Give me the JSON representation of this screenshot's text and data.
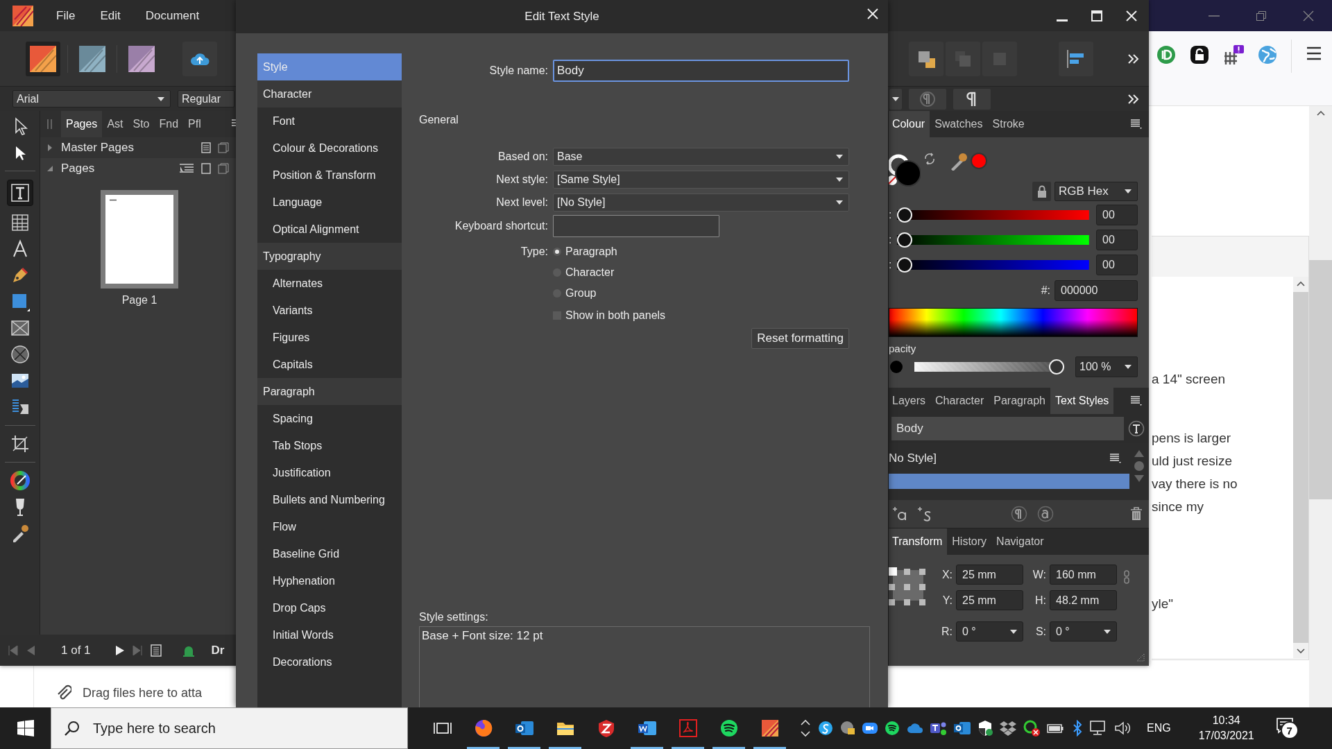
{
  "browser": {
    "text_lines": [
      [
        "a 14\" screen"
      ],
      [
        "pens is larger",
        "uld just resize",
        "vay there is no",
        "since my"
      ],
      [
        "yle\""
      ]
    ],
    "drop_hint": "Drag files here to atta"
  },
  "affinity": {
    "menu": [
      "File",
      "Edit",
      "Document"
    ],
    "font_family": "Arial",
    "font_style": "Regular",
    "pages_panel": {
      "tabs": [
        {
          "label": "Pages",
          "selected": true
        },
        {
          "label": "Ast",
          "selected": false
        },
        {
          "label": "Sto",
          "selected": false
        },
        {
          "label": "Fnd",
          "selected": false
        },
        {
          "label": "Pfl",
          "selected": false
        }
      ],
      "sections": [
        {
          "label": "Master Pages",
          "expanded": false
        },
        {
          "label": "Pages",
          "expanded": true
        }
      ],
      "page_label": "Page 1"
    },
    "status_bar": {
      "page_count": "1 of 1",
      "label": "Dr"
    },
    "colour_panel": {
      "tabs": [
        {
          "label": "Colour",
          "selected": true
        },
        {
          "label": "Swatches",
          "selected": false
        },
        {
          "label": "Stroke",
          "selected": false
        }
      ],
      "model": "RGB Hex",
      "channels": [
        {
          "label": ":",
          "level": 0,
          "value": "00"
        },
        {
          "label": ":",
          "level": 0,
          "value": "00"
        },
        {
          "label": ":",
          "level": 0,
          "value": "00"
        }
      ],
      "hex_label": "#:",
      "hex": "000000",
      "opacity_label": "pacity",
      "opacity": {
        "level": 1,
        "value": "100 %"
      }
    },
    "styles_panel": {
      "tabs": [
        {
          "label": "Layers",
          "selected": false
        },
        {
          "label": "Character",
          "selected": false
        },
        {
          "label": "Paragraph",
          "selected": false
        },
        {
          "label": "Text Styles",
          "selected": true
        }
      ],
      "current": "Body",
      "styles": [
        {
          "label": "No Style]",
          "selected": false
        },
        {
          "selected": true
        }
      ]
    },
    "transform_panel": {
      "tabs": [
        {
          "label": "Transform",
          "selected": true
        },
        {
          "label": "History",
          "selected": false
        },
        {
          "label": "Navigator",
          "selected": false
        }
      ],
      "fields": [
        {
          "label": "X:",
          "value": "25 mm",
          "kind": "field"
        },
        {
          "label": "W:",
          "value": "160 mm",
          "kind": "field"
        },
        {
          "label": "Y:",
          "value": "25 mm",
          "kind": "field"
        },
        {
          "label": "H:",
          "value": "48.2 mm",
          "kind": "field"
        },
        {
          "label": "R:",
          "value": "0 °",
          "kind": "dropdown"
        },
        {
          "label": "S:",
          "value": "0 °",
          "kind": "dropdown"
        }
      ]
    }
  },
  "dialog": {
    "title": "Edit Text Style",
    "nav": [
      {
        "label": "Style",
        "kind": "group",
        "selected": true
      },
      {
        "label": "Character",
        "kind": "group",
        "selected": false
      },
      {
        "label": "Font",
        "kind": "item",
        "selected": false
      },
      {
        "label": "Colour & Decorations",
        "kind": "item",
        "selected": false
      },
      {
        "label": "Position & Transform",
        "kind": "item",
        "selected": false
      },
      {
        "label": "Language",
        "kind": "item",
        "selected": false
      },
      {
        "label": "Optical Alignment",
        "kind": "item",
        "selected": false
      },
      {
        "label": "Typography",
        "kind": "group",
        "selected": false
      },
      {
        "label": "Alternates",
        "kind": "item",
        "selected": false
      },
      {
        "label": "Variants",
        "kind": "item",
        "selected": false
      },
      {
        "label": "Figures",
        "kind": "item",
        "selected": false
      },
      {
        "label": "Capitals",
        "kind": "item",
        "selected": false
      },
      {
        "label": "Paragraph",
        "kind": "group",
        "selected": false
      },
      {
        "label": "Spacing",
        "kind": "item",
        "selected": false
      },
      {
        "label": "Tab Stops",
        "kind": "item",
        "selected": false
      },
      {
        "label": "Justification",
        "kind": "item",
        "selected": false
      },
      {
        "label": "Bullets and Numbering",
        "kind": "item",
        "selected": false
      },
      {
        "label": "Flow",
        "kind": "item",
        "selected": false
      },
      {
        "label": "Baseline Grid",
        "kind": "item",
        "selected": false
      },
      {
        "label": "Hyphenation",
        "kind": "item",
        "selected": false
      },
      {
        "label": "Drop Caps",
        "kind": "item",
        "selected": false
      },
      {
        "label": "Initial Words",
        "kind": "item",
        "selected": false
      },
      {
        "label": "Decorations",
        "kind": "item",
        "selected": false
      }
    ],
    "style_name_label": "Style name:",
    "style_name": "Body",
    "section": "General",
    "fields": [
      {
        "label": "Based on:",
        "value": "Base"
      },
      {
        "label": "Next style:",
        "value": "[Same Style]"
      },
      {
        "label": "Next level:",
        "value": "[No Style]"
      }
    ],
    "shortcut_label": "Keyboard shortcut:",
    "type_label": "Type:",
    "types": [
      {
        "label": "Paragraph",
        "selected": true
      },
      {
        "label": "Character",
        "selected": false
      },
      {
        "label": "Group",
        "selected": false
      }
    ],
    "show_both": {
      "label": "Show in both panels",
      "checked": false
    },
    "reset_button": "Reset formatting",
    "settings_label": "Style settings:",
    "settings_text": "Base + Font size: 12 pt"
  },
  "taskbar": {
    "search_placeholder": "Type here to search",
    "language": "ENG",
    "time": "10:34",
    "date": "17/03/2021",
    "notifications": "7"
  }
}
